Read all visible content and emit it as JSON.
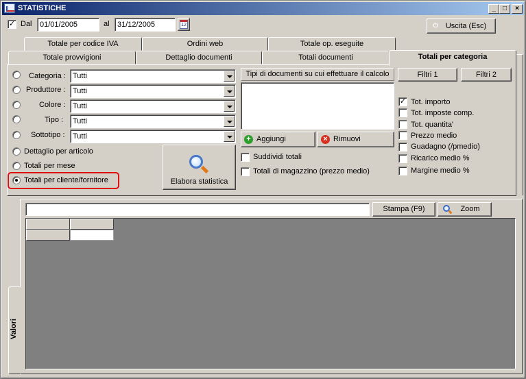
{
  "window": {
    "title": "STATISTICHE",
    "minimize_glyph": "_",
    "maximize_glyph": "□",
    "close_glyph": "×"
  },
  "date_range": {
    "dal_label": "Dal",
    "dal_checked": "✓",
    "from_value": "01/01/2005",
    "al_label": "al",
    "to_value": "31/12/2005",
    "calendar_icon_text": "12"
  },
  "exit_button": {
    "label": "Uscita (Esc)",
    "icon": "exit-icon",
    "icon_color": "#d83020"
  },
  "tabs_row1": [
    {
      "label": "Totale per codice IVA"
    },
    {
      "label": "Ordini web"
    },
    {
      "label": "Totale op. eseguite"
    }
  ],
  "tabs_row2": [
    {
      "label": "Totale provvigioni"
    },
    {
      "label": "Dettaglio documenti"
    },
    {
      "label": "Totali documenti"
    },
    {
      "label": "Totali per categoria"
    }
  ],
  "filters": [
    {
      "label": "Categoria :",
      "value": "Tutti"
    },
    {
      "label": "Produttore :",
      "value": "Tutti"
    },
    {
      "label": "Colore :",
      "value": "Tutti"
    },
    {
      "label": "Tipo :",
      "value": "Tutti"
    },
    {
      "label": "Sottotipo :",
      "value": "Tutti"
    }
  ],
  "grouping": [
    {
      "label": "Dettaglio per articolo"
    },
    {
      "label": "Totali per mese"
    },
    {
      "label": "Totali per cliente/fornitore"
    }
  ],
  "highlight_color": "#e01010",
  "elabora_button": {
    "label": "Elabora statistica",
    "icon": "magnifier-icon"
  },
  "doc_types": {
    "header": "Tipi di documenti su cui effettuare il calcolo",
    "add_label": "Aggiungi",
    "add_color": "#2c9e2c",
    "remove_label": "Rimuovi",
    "remove_color": "#d83020",
    "suddividi_label": "Suddividi totali",
    "magazzino_label": "Totali di magazzino (prezzo medio)"
  },
  "filter_buttons": {
    "filtri1": "Filtri 1",
    "filtri2": "Filtri 2"
  },
  "options": [
    {
      "label": "Tot. importo",
      "checked": "✓"
    },
    {
      "label": "Tot. imposte comp.",
      "checked": ""
    },
    {
      "label": "Tot. quantita'",
      "checked": ""
    },
    {
      "label": "Prezzo medio",
      "checked": ""
    },
    {
      "label": "Guadagno (/pmedio)",
      "checked": ""
    },
    {
      "label": "Ricarico medio %",
      "checked": ""
    },
    {
      "label": "Margine medio %",
      "checked": ""
    }
  ],
  "results": {
    "side_tab": "Valori",
    "search_value": "",
    "stampa_label": "Stampa (F9)",
    "zoom_label": "Zoom",
    "grid_bg": "#808080"
  }
}
